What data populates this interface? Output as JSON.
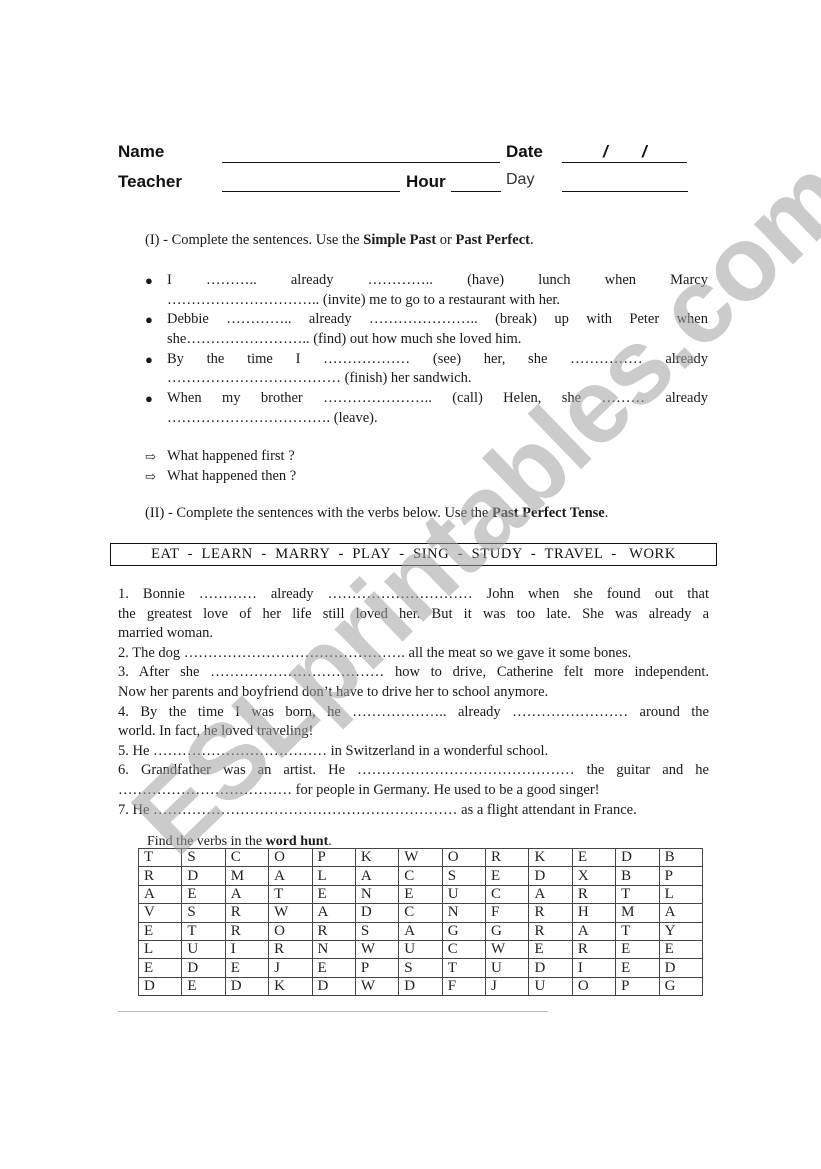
{
  "header": {
    "name_label": "Name",
    "date_label": "Date",
    "date_slash_1": "/",
    "date_slash_2": "/",
    "teacher_label": "Teacher",
    "hour_label": "Hour",
    "day_label": "Day"
  },
  "section1": {
    "numeral": "(I)",
    "instruction_prefix": " - Complete the sentences. Use the ",
    "bold_1": "Simple Past",
    "instruction_mid": " or ",
    "bold_2": "Past Perfect",
    "instruction_end": ".",
    "items": [
      {
        "line1": "I  ………..  already  …………..  (have)  lunch  when  Marcy",
        "line2": "………………………….. (invite) me to go to a restaurant with her."
      },
      {
        "line1": "Debbie  …………..  already  …………………..  (break)  up  with  Peter  when",
        "line2": "she…………………….. (find) out how much she loved him."
      },
      {
        "line1": "By  the  time  I  ………………   (see)  her,  she  ……………  already",
        "line2": "……………………………… (finish) her sandwich."
      },
      {
        "line1": "When  my  brother  …………………..  (call)  Helen,  she  ………  already",
        "line2": "……………………………. (leave)."
      }
    ],
    "questions": [
      "What happened first ?",
      "What happened then ?"
    ]
  },
  "section2": {
    "numeral": "(II)",
    "instruction_prefix": " - Complete the sentences with the verbs below.  Use the ",
    "bold": "Past Perfect Tense",
    "instruction_end": ".",
    "verbs": "EAT  -  LEARN  -  MARRY  -  PLAY  -  SING  -  STUDY  -  TRAVEL  -   WORK",
    "sentences": [
      {
        "line": "1. Bonnie  …………  already  …………………………  John when she found out that",
        "justify": true
      },
      {
        "line": "the greatest love of her life still loved her.  But it was too late.  She was already a",
        "justify": true
      },
      {
        "line": "married woman.",
        "justify": false
      },
      {
        "line": "2. The dog ………………………………………. all the meat so we gave it some bones.",
        "justify": false
      },
      {
        "line": "3. After she ……………………………… how to drive, Catherine felt more independent.",
        "justify": true
      },
      {
        "line": "Now her parents and boyfriend don’t have to drive her to school anymore.",
        "justify": false
      },
      {
        "line": "4. By the time I was born, he  ……………….. already  ……………………  around the",
        "justify": true
      },
      {
        "line": "world. In fact, he loved traveling!",
        "justify": false
      },
      {
        "line": "5. He  ……………………………… in Switzerland in a wonderful school.",
        "justify": false
      },
      {
        "line": "6. Grandfather was an artist. He  ……………………………………… the guitar and he",
        "justify": true
      },
      {
        "line": "……………………………… for people in Germany. He used to be a good singer!",
        "justify": false
      },
      {
        "line": "7. He ……………………………………………………… as a flight attendant in France.",
        "justify": false
      }
    ]
  },
  "wordhunt": {
    "instruction_prefix": "Find the verbs in the ",
    "bold": "word hunt",
    "instruction_end": ".",
    "grid": [
      [
        "T",
        "S",
        "C",
        "O",
        "P",
        "K",
        "W",
        "O",
        "R",
        "K",
        "E",
        "D",
        "B"
      ],
      [
        "R",
        "D",
        "M",
        "A",
        "L",
        "A",
        "C",
        "S",
        "E",
        "D",
        "X",
        "B",
        "P"
      ],
      [
        "A",
        "E",
        "A",
        "T",
        "E",
        "N",
        "E",
        "U",
        "C",
        "A",
        "R",
        "T",
        "L"
      ],
      [
        "V",
        "S",
        "R",
        "W",
        "A",
        "D",
        "C",
        "N",
        "F",
        "R",
        "H",
        "M",
        "A"
      ],
      [
        "E",
        "T",
        "R",
        "O",
        "R",
        "S",
        "A",
        "G",
        "G",
        "R",
        "A",
        "T",
        "Y"
      ],
      [
        "L",
        "U",
        "I",
        "R",
        "N",
        "W",
        "U",
        "C",
        "W",
        "E",
        "R",
        "E",
        "E"
      ],
      [
        "E",
        "D",
        "E",
        "J",
        "E",
        "P",
        "S",
        "T",
        "U",
        "D",
        "I",
        "E",
        "D"
      ],
      [
        "D",
        "E",
        "D",
        "K",
        "D",
        "W",
        "D",
        "F",
        "J",
        "U",
        "O",
        "P",
        "G"
      ]
    ]
  },
  "watermark": "ESLprintables.com"
}
